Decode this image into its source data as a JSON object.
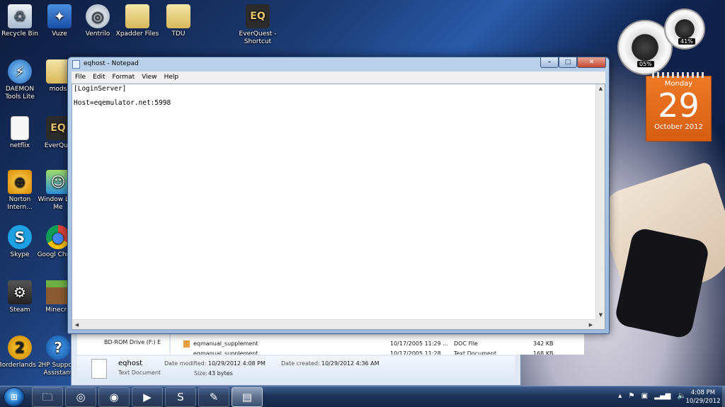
{
  "desktop": {
    "icons": [
      {
        "label": "Recycle Bin",
        "icon": "recycle-bin-icon"
      },
      {
        "label": "Vuze",
        "icon": "vuze-icon"
      },
      {
        "label": "Ventrilo",
        "icon": "ventrilo-icon"
      },
      {
        "label": "Xpadder Files",
        "icon": "folder-icon"
      },
      {
        "label": "TDU",
        "icon": "folder-icon"
      },
      {
        "label": "EverQuest - Shortcut",
        "icon": "everquest-icon"
      },
      {
        "label": "DAEMON Tools Lite",
        "icon": "daemon-tools-icon"
      },
      {
        "label": "mods",
        "icon": "folder-icon"
      },
      {
        "label": "netflix",
        "icon": "document-icon"
      },
      {
        "label": "EverQue",
        "icon": "everquest-icon"
      },
      {
        "label": "Norton Intern...",
        "icon": "norton-icon"
      },
      {
        "label": "Window Live Me",
        "icon": "windows-live-icon"
      },
      {
        "label": "Skype",
        "icon": "skype-icon"
      },
      {
        "label": "Googl Chrom",
        "icon": "chrome-icon"
      },
      {
        "label": "Steam",
        "icon": "steam-icon"
      },
      {
        "label": "Minecra",
        "icon": "minecraft-icon"
      },
      {
        "label": "Borderlands 2",
        "icon": "borderlands-icon"
      },
      {
        "label": "HP Suppor Assistant",
        "icon": "help-icon"
      }
    ]
  },
  "gadgets": {
    "cpu_percent": "05%",
    "memory_percent": "41%",
    "calendar": {
      "weekday": "Monday",
      "day": "29",
      "month_year": "October 2012"
    }
  },
  "explorer": {
    "nav_item": "BD-ROM Drive (F:) E",
    "files": [
      {
        "name": "eqmanual_supplement",
        "date": "10/17/2005 11:29 ...",
        "type": "DOC File",
        "size": "342 KB"
      },
      {
        "name": "eqmanual_supplement",
        "date": "10/17/2005 11:28 ...",
        "type": "Text Document",
        "size": "168 KB"
      }
    ],
    "details": {
      "name": "eqhost",
      "type": "Text Document",
      "modified_label": "Date modified:",
      "modified": "10/29/2012 4:08 PM",
      "size_label": "Size:",
      "size": "43 bytes",
      "created_label": "Date created:",
      "created": "10/29/2012 4:36 AM"
    }
  },
  "notepad": {
    "title": "eqhost - Notepad",
    "menu": [
      "File",
      "Edit",
      "Format",
      "View",
      "Help"
    ],
    "content": "[LoginServer]\n\nHost=eqemulator.net:5998"
  },
  "taskbar": {
    "buttons": [
      {
        "icon": "explorer-folder-icon",
        "active": false
      },
      {
        "icon": "ventrilo-icon",
        "active": false
      },
      {
        "icon": "chrome-icon",
        "active": false
      },
      {
        "icon": "media-player-icon",
        "active": false
      },
      {
        "icon": "skype-icon",
        "active": false
      },
      {
        "icon": "paint-icon",
        "active": false
      },
      {
        "icon": "notepad-icon",
        "active": true
      }
    ],
    "time": "4:08 PM",
    "date": "10/29/2012"
  }
}
